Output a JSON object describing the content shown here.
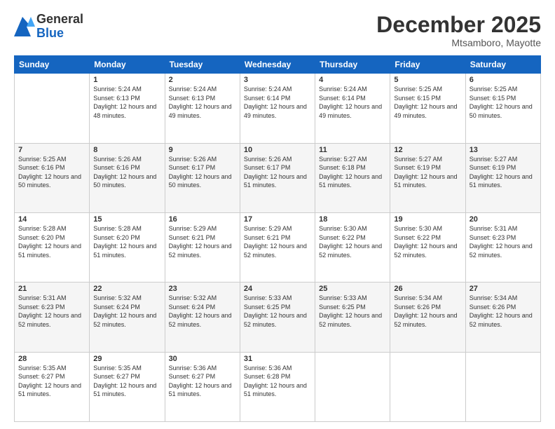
{
  "header": {
    "logo_line1": "General",
    "logo_line2": "Blue",
    "title": "December 2025",
    "subtitle": "Mtsamboro, Mayotte"
  },
  "calendar": {
    "days_of_week": [
      "Sunday",
      "Monday",
      "Tuesday",
      "Wednesday",
      "Thursday",
      "Friday",
      "Saturday"
    ],
    "weeks": [
      [
        {
          "day": "",
          "sunrise": "",
          "sunset": "",
          "daylight": ""
        },
        {
          "day": "1",
          "sunrise": "Sunrise: 5:24 AM",
          "sunset": "Sunset: 6:13 PM",
          "daylight": "Daylight: 12 hours and 48 minutes."
        },
        {
          "day": "2",
          "sunrise": "Sunrise: 5:24 AM",
          "sunset": "Sunset: 6:13 PM",
          "daylight": "Daylight: 12 hours and 49 minutes."
        },
        {
          "day": "3",
          "sunrise": "Sunrise: 5:24 AM",
          "sunset": "Sunset: 6:14 PM",
          "daylight": "Daylight: 12 hours and 49 minutes."
        },
        {
          "day": "4",
          "sunrise": "Sunrise: 5:24 AM",
          "sunset": "Sunset: 6:14 PM",
          "daylight": "Daylight: 12 hours and 49 minutes."
        },
        {
          "day": "5",
          "sunrise": "Sunrise: 5:25 AM",
          "sunset": "Sunset: 6:15 PM",
          "daylight": "Daylight: 12 hours and 49 minutes."
        },
        {
          "day": "6",
          "sunrise": "Sunrise: 5:25 AM",
          "sunset": "Sunset: 6:15 PM",
          "daylight": "Daylight: 12 hours and 50 minutes."
        }
      ],
      [
        {
          "day": "7",
          "sunrise": "Sunrise: 5:25 AM",
          "sunset": "Sunset: 6:16 PM",
          "daylight": "Daylight: 12 hours and 50 minutes."
        },
        {
          "day": "8",
          "sunrise": "Sunrise: 5:26 AM",
          "sunset": "Sunset: 6:16 PM",
          "daylight": "Daylight: 12 hours and 50 minutes."
        },
        {
          "day": "9",
          "sunrise": "Sunrise: 5:26 AM",
          "sunset": "Sunset: 6:17 PM",
          "daylight": "Daylight: 12 hours and 50 minutes."
        },
        {
          "day": "10",
          "sunrise": "Sunrise: 5:26 AM",
          "sunset": "Sunset: 6:17 PM",
          "daylight": "Daylight: 12 hours and 51 minutes."
        },
        {
          "day": "11",
          "sunrise": "Sunrise: 5:27 AM",
          "sunset": "Sunset: 6:18 PM",
          "daylight": "Daylight: 12 hours and 51 minutes."
        },
        {
          "day": "12",
          "sunrise": "Sunrise: 5:27 AM",
          "sunset": "Sunset: 6:19 PM",
          "daylight": "Daylight: 12 hours and 51 minutes."
        },
        {
          "day": "13",
          "sunrise": "Sunrise: 5:27 AM",
          "sunset": "Sunset: 6:19 PM",
          "daylight": "Daylight: 12 hours and 51 minutes."
        }
      ],
      [
        {
          "day": "14",
          "sunrise": "Sunrise: 5:28 AM",
          "sunset": "Sunset: 6:20 PM",
          "daylight": "Daylight: 12 hours and 51 minutes."
        },
        {
          "day": "15",
          "sunrise": "Sunrise: 5:28 AM",
          "sunset": "Sunset: 6:20 PM",
          "daylight": "Daylight: 12 hours and 51 minutes."
        },
        {
          "day": "16",
          "sunrise": "Sunrise: 5:29 AM",
          "sunset": "Sunset: 6:21 PM",
          "daylight": "Daylight: 12 hours and 52 minutes."
        },
        {
          "day": "17",
          "sunrise": "Sunrise: 5:29 AM",
          "sunset": "Sunset: 6:21 PM",
          "daylight": "Daylight: 12 hours and 52 minutes."
        },
        {
          "day": "18",
          "sunrise": "Sunrise: 5:30 AM",
          "sunset": "Sunset: 6:22 PM",
          "daylight": "Daylight: 12 hours and 52 minutes."
        },
        {
          "day": "19",
          "sunrise": "Sunrise: 5:30 AM",
          "sunset": "Sunset: 6:22 PM",
          "daylight": "Daylight: 12 hours and 52 minutes."
        },
        {
          "day": "20",
          "sunrise": "Sunrise: 5:31 AM",
          "sunset": "Sunset: 6:23 PM",
          "daylight": "Daylight: 12 hours and 52 minutes."
        }
      ],
      [
        {
          "day": "21",
          "sunrise": "Sunrise: 5:31 AM",
          "sunset": "Sunset: 6:23 PM",
          "daylight": "Daylight: 12 hours and 52 minutes."
        },
        {
          "day": "22",
          "sunrise": "Sunrise: 5:32 AM",
          "sunset": "Sunset: 6:24 PM",
          "daylight": "Daylight: 12 hours and 52 minutes."
        },
        {
          "day": "23",
          "sunrise": "Sunrise: 5:32 AM",
          "sunset": "Sunset: 6:24 PM",
          "daylight": "Daylight: 12 hours and 52 minutes."
        },
        {
          "day": "24",
          "sunrise": "Sunrise: 5:33 AM",
          "sunset": "Sunset: 6:25 PM",
          "daylight": "Daylight: 12 hours and 52 minutes."
        },
        {
          "day": "25",
          "sunrise": "Sunrise: 5:33 AM",
          "sunset": "Sunset: 6:25 PM",
          "daylight": "Daylight: 12 hours and 52 minutes."
        },
        {
          "day": "26",
          "sunrise": "Sunrise: 5:34 AM",
          "sunset": "Sunset: 6:26 PM",
          "daylight": "Daylight: 12 hours and 52 minutes."
        },
        {
          "day": "27",
          "sunrise": "Sunrise: 5:34 AM",
          "sunset": "Sunset: 6:26 PM",
          "daylight": "Daylight: 12 hours and 52 minutes."
        }
      ],
      [
        {
          "day": "28",
          "sunrise": "Sunrise: 5:35 AM",
          "sunset": "Sunset: 6:27 PM",
          "daylight": "Daylight: 12 hours and 51 minutes."
        },
        {
          "day": "29",
          "sunrise": "Sunrise: 5:35 AM",
          "sunset": "Sunset: 6:27 PM",
          "daylight": "Daylight: 12 hours and 51 minutes."
        },
        {
          "day": "30",
          "sunrise": "Sunrise: 5:36 AM",
          "sunset": "Sunset: 6:27 PM",
          "daylight": "Daylight: 12 hours and 51 minutes."
        },
        {
          "day": "31",
          "sunrise": "Sunrise: 5:36 AM",
          "sunset": "Sunset: 6:28 PM",
          "daylight": "Daylight: 12 hours and 51 minutes."
        },
        {
          "day": "",
          "sunrise": "",
          "sunset": "",
          "daylight": ""
        },
        {
          "day": "",
          "sunrise": "",
          "sunset": "",
          "daylight": ""
        },
        {
          "day": "",
          "sunrise": "",
          "sunset": "",
          "daylight": ""
        }
      ]
    ]
  }
}
